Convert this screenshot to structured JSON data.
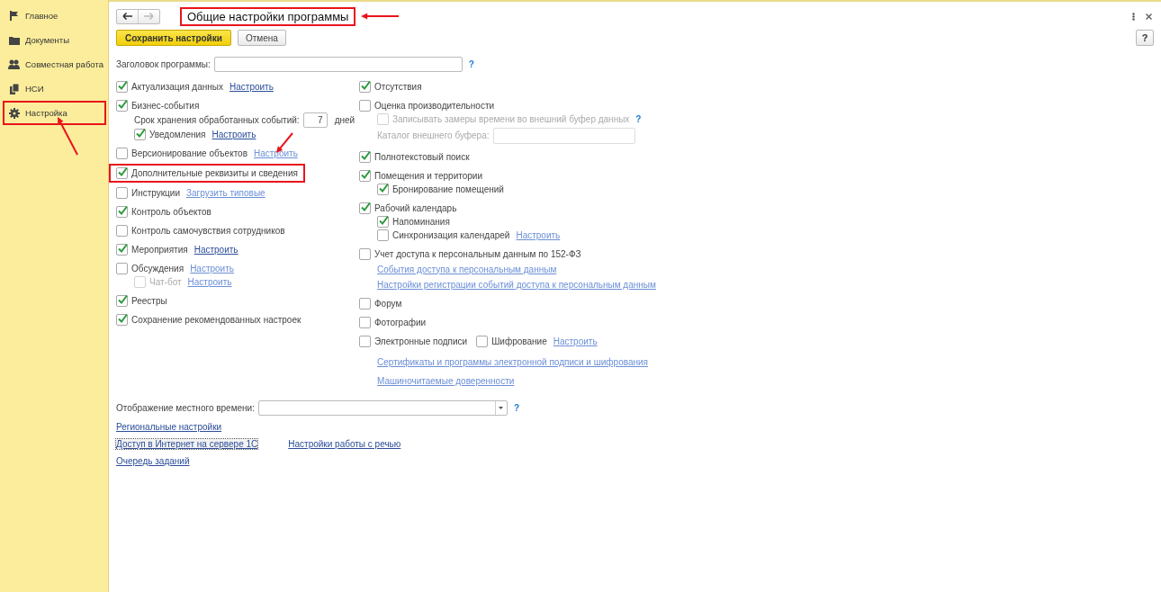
{
  "sidebar": {
    "items": [
      {
        "label": "Главное",
        "annotated": false
      },
      {
        "label": "Документы",
        "annotated": false
      },
      {
        "label": "Совместная работа",
        "annotated": false
      },
      {
        "label": "НСИ",
        "annotated": false
      },
      {
        "label": "Настройка",
        "annotated": true
      }
    ]
  },
  "form": {
    "title": "Общие настройки программы",
    "title_annotated": true,
    "nav": {
      "back_disabled": false,
      "forward_disabled": true
    },
    "buttons": [
      {
        "label": "Сохранить настройки",
        "kind": "primary"
      },
      {
        "label": "Отмена",
        "kind": "normal"
      }
    ],
    "help_button": "?",
    "program_title": {
      "label": "Заголовок программы:",
      "help": "?"
    },
    "left_options": [
      {
        "kind": "checkbox",
        "label": "Актуализация данных",
        "checked": true,
        "link": {
          "text": "Настроить",
          "dim": false
        }
      },
      {
        "kind": "checkbox",
        "label": "Бизнес-события",
        "checked": true,
        "children": [
          {
            "kind": "number",
            "label": "Срок хранения обработанных событий:",
            "value": "7",
            "unit": "дней"
          },
          {
            "kind": "checkbox",
            "label": "Уведомления",
            "checked": true,
            "link": {
              "text": "Настроить",
              "dim": false
            }
          }
        ]
      },
      {
        "kind": "checkbox",
        "label": "Версионирование объектов",
        "checked": false,
        "link": {
          "text": "Настроить",
          "dim": true
        }
      },
      {
        "kind": "checkbox",
        "label": "Дополнительные реквизиты и сведения",
        "checked": true,
        "annotated": true
      },
      {
        "kind": "checkbox",
        "label": "Инструкции",
        "checked": false,
        "link": {
          "text": "Загрузить типовые",
          "dim": true
        }
      },
      {
        "kind": "checkbox",
        "label": "Контроль объектов",
        "checked": true
      },
      {
        "kind": "checkbox",
        "label": "Контроль самочувствия сотрудников",
        "checked": false
      },
      {
        "kind": "checkbox",
        "label": "Мероприятия",
        "checked": true,
        "link": {
          "text": "Настроить",
          "dim": false
        }
      },
      {
        "kind": "checkbox",
        "label": "Обсуждения",
        "checked": false,
        "link": {
          "text": "Настроить",
          "dim": true
        },
        "children": [
          {
            "kind": "checkbox",
            "label": "Чат-бот",
            "checked": false,
            "disabled": true,
            "link": {
              "text": "Настроить",
              "dim": true
            }
          }
        ]
      },
      {
        "kind": "checkbox",
        "label": "Реестры",
        "checked": true
      },
      {
        "kind": "checkbox",
        "label": "Сохранение рекомендованных настроек",
        "checked": true
      }
    ],
    "right_options": [
      {
        "kind": "checkbox",
        "label": "Отсутствия",
        "checked": true
      },
      {
        "kind": "checkbox",
        "label": "Оценка производительности",
        "checked": false,
        "children": [
          {
            "kind": "checkbox",
            "label": "Записывать замеры времени во внешний буфер данных",
            "checked": false,
            "disabled": true,
            "help": "?"
          },
          {
            "kind": "text",
            "label": "Каталог внешнего буфера:",
            "disabled": true
          }
        ]
      },
      {
        "kind": "checkbox",
        "label": "Полнотекстовый поиск",
        "checked": true
      },
      {
        "kind": "checkbox",
        "label": "Помещения и территории",
        "checked": true,
        "children": [
          {
            "kind": "checkbox",
            "label": "Бронирование помещений",
            "checked": true
          }
        ]
      },
      {
        "kind": "checkbox",
        "label": "Рабочий календарь",
        "checked": true,
        "children": [
          {
            "kind": "checkbox",
            "label": "Напоминания",
            "checked": true
          },
          {
            "kind": "checkbox",
            "label": "Синхронизация календарей",
            "checked": false,
            "link": {
              "text": "Настроить",
              "dim": true
            }
          }
        ]
      },
      {
        "kind": "checkbox",
        "label": "Учет доступа к персональным данным по 152-ФЗ",
        "checked": false,
        "children": [
          {
            "kind": "link",
            "text": "События доступа к персональным данным",
            "dim": true
          },
          {
            "kind": "link",
            "text": "Настройки регистрации событий доступа к персональным данным",
            "dim": true
          }
        ]
      },
      {
        "kind": "checkbox",
        "label": "Форум",
        "checked": false
      },
      {
        "kind": "checkbox",
        "label": "Фотографии",
        "checked": false
      },
      {
        "kind": "checkbox",
        "label": "Электронные подписи",
        "checked": false,
        "extra": {
          "label": "Шифрование",
          "checked": false
        },
        "link": {
          "text": "Настроить",
          "dim": true
        },
        "children": [
          {
            "kind": "link",
            "text": "Сертификаты и программы электронной подписи и шифрования",
            "dim": true
          },
          {
            "kind": "link",
            "text": "Машиночитаемые доверенности",
            "dim": true
          }
        ]
      }
    ],
    "local_time": {
      "label": "Отображение местного времени:",
      "help": "?"
    },
    "bottom_links": [
      [
        {
          "text": "Региональные настройки",
          "focused": false
        }
      ],
      [
        {
          "text": "Доступ в Интернет на сервере 1С",
          "focused": true
        },
        {
          "text": "Настройки работы с речью",
          "focused": false
        }
      ],
      [
        {
          "text": "Очередь заданий",
          "focused": false
        }
      ]
    ]
  }
}
